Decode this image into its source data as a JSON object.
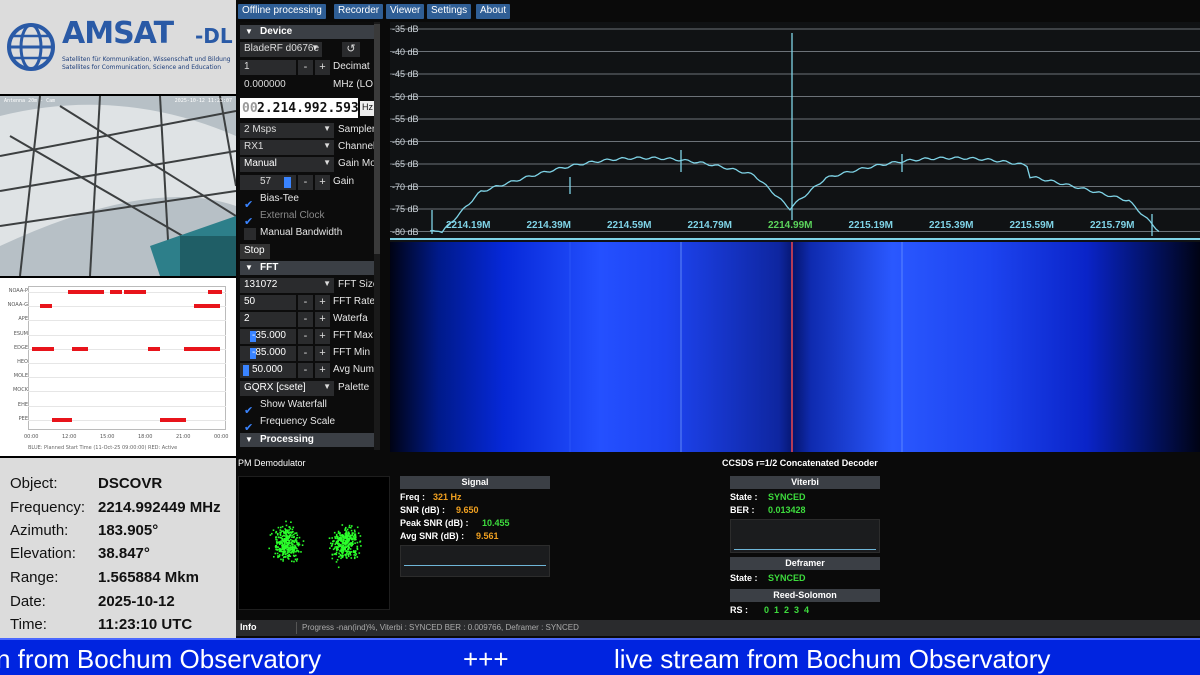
{
  "logo": {
    "brand": "AMSAT",
    "brand_suffix": "-DL",
    "tagline_1": "Satelliten für Kommunikation, Wissenschaft und Bildung",
    "tagline_2": "Satellites for Communication, Science and Education"
  },
  "camera": {
    "overlay_left": "Antenna 20m - Cam",
    "overlay_right": "2025-10-12 11:23:07"
  },
  "schedule": {
    "rows": [
      "NOAA-P",
      "NOAA-G",
      "APE",
      "ESUM",
      "EDGE",
      "HEO",
      "MOLE",
      "MOCK",
      "EHE",
      "PEE"
    ],
    "ticks": [
      "00:00",
      "12:00",
      "15:00",
      "18:00",
      "21:00",
      "00:00"
    ],
    "footer": "BLUE: Planned   Start Time (11-Oct-25 09:00:00)   RED: Active"
  },
  "tracking": {
    "object_label": "Object:",
    "object": "DSCOVR",
    "frequency_label": "Frequency:",
    "frequency": "2214.992449 MHz",
    "azimuth_label": "Azimuth:",
    "azimuth": "183.905°",
    "elevation_label": "Elevation:",
    "elevation": "38.847°",
    "range_label": "Range:",
    "range": "1.565884 Mkm",
    "date_label": "Date:",
    "date": "2025-10-12",
    "time_label": "Time:",
    "time": "11:23:10 UTC"
  },
  "menubar": [
    "Offline processing",
    "Recorder",
    "Viewer",
    "Settings",
    "About"
  ],
  "device": {
    "section": "Device",
    "device_name": "BladeRF d0676e",
    "reset_icon": "refresh-icon",
    "decim_value": "1",
    "decim_label": "Decimat",
    "offset_value": "0.000000",
    "offset_label": "MHz (LO",
    "freq_prefix": "00",
    "freq_value": "2.214.992.593",
    "freq_unit": "Hz",
    "samplerate": "2 Msps",
    "samplerate_label": "Sampler",
    "channel": "RX1",
    "channel_label": "Channel",
    "gain_mode": "Manual",
    "gain_mode_label": "Gain Mo",
    "gain_value": "57",
    "gain_label": "Gain",
    "bias_tee": "Bias-Tee",
    "external_clock": "External Clock",
    "manual_bandwidth": "Manual Bandwidth",
    "stop": "Stop"
  },
  "fft_panel": {
    "section": "FFT",
    "fft_size": "131072",
    "fft_size_label": "FFT Size",
    "fft_rate": "50",
    "fft_rate_label": "FFT Rate",
    "waterfall_rate": "2",
    "waterfall_rate_label": "Waterfa",
    "fft_max": "-35.000",
    "fft_max_label": "FFT Max",
    "fft_min": "-85.000",
    "fft_min_label": "FFT Min",
    "avg": "50.000",
    "avg_label": "Avg Num",
    "palette": "GQRX [csete]",
    "palette_label": "Palette",
    "show_waterfall": "Show Waterfall",
    "frequency_scale": "Frequency Scale"
  },
  "processing": {
    "section": "Processing"
  },
  "spectrum": {
    "db_labels": [
      "-35 dB",
      "-40 dB",
      "-45 dB",
      "-50 dB",
      "-55 dB",
      "-60 dB",
      "-65 dB",
      "-70 dB",
      "-75 dB",
      "-80 dB"
    ],
    "freq_labels": [
      "2214.19M",
      "2214.39M",
      "2214.59M",
      "2214.79M",
      "2214.99M",
      "2215.19M",
      "2215.39M",
      "2215.59M",
      "2215.79M"
    ],
    "center_label": "2214.99M",
    "trace_color": "#7fd3e6",
    "center_color": "#5bd35b"
  },
  "pm": {
    "title": "PM Demodulator",
    "signal_header": "Signal",
    "freq_label": "Freq :",
    "freq": "321 Hz",
    "snr_label": "SNR (dB) :",
    "snr": "9.650",
    "peak_label": "Peak SNR (dB) :",
    "peak": "10.455",
    "avg_label": "Avg SNR (dB) :",
    "avg": "9.561"
  },
  "decoder": {
    "title": "CCSDS r=1/2 Concatenated Decoder",
    "viterbi_header": "Viterbi",
    "state_label": "State :",
    "viterbi_state": "SYNCED",
    "ber_label": "BER :",
    "ber": "0.013428",
    "deframer_header": "Deframer",
    "deframer_state_label": "State :",
    "deframer_state": "SYNCED",
    "rs_header": "Reed-Solomon",
    "rs_label": "RS :",
    "rs_values": "0  1  2  3  4"
  },
  "infobar": {
    "label": "Info",
    "text": "Progress -nan(ind)%, Viterbi : SYNCED BER : 0.009766, Deframer : SYNCED"
  },
  "ticker": {
    "part1": "n from Bochum Observatory",
    "sep": "+++",
    "part2": "live stream from Bochum Observatory"
  },
  "colors": {
    "accent": "#2f5e95",
    "synced": "#3ddc3d",
    "value_orange": "#f0a020",
    "ticker_bg": "#0024e0"
  }
}
